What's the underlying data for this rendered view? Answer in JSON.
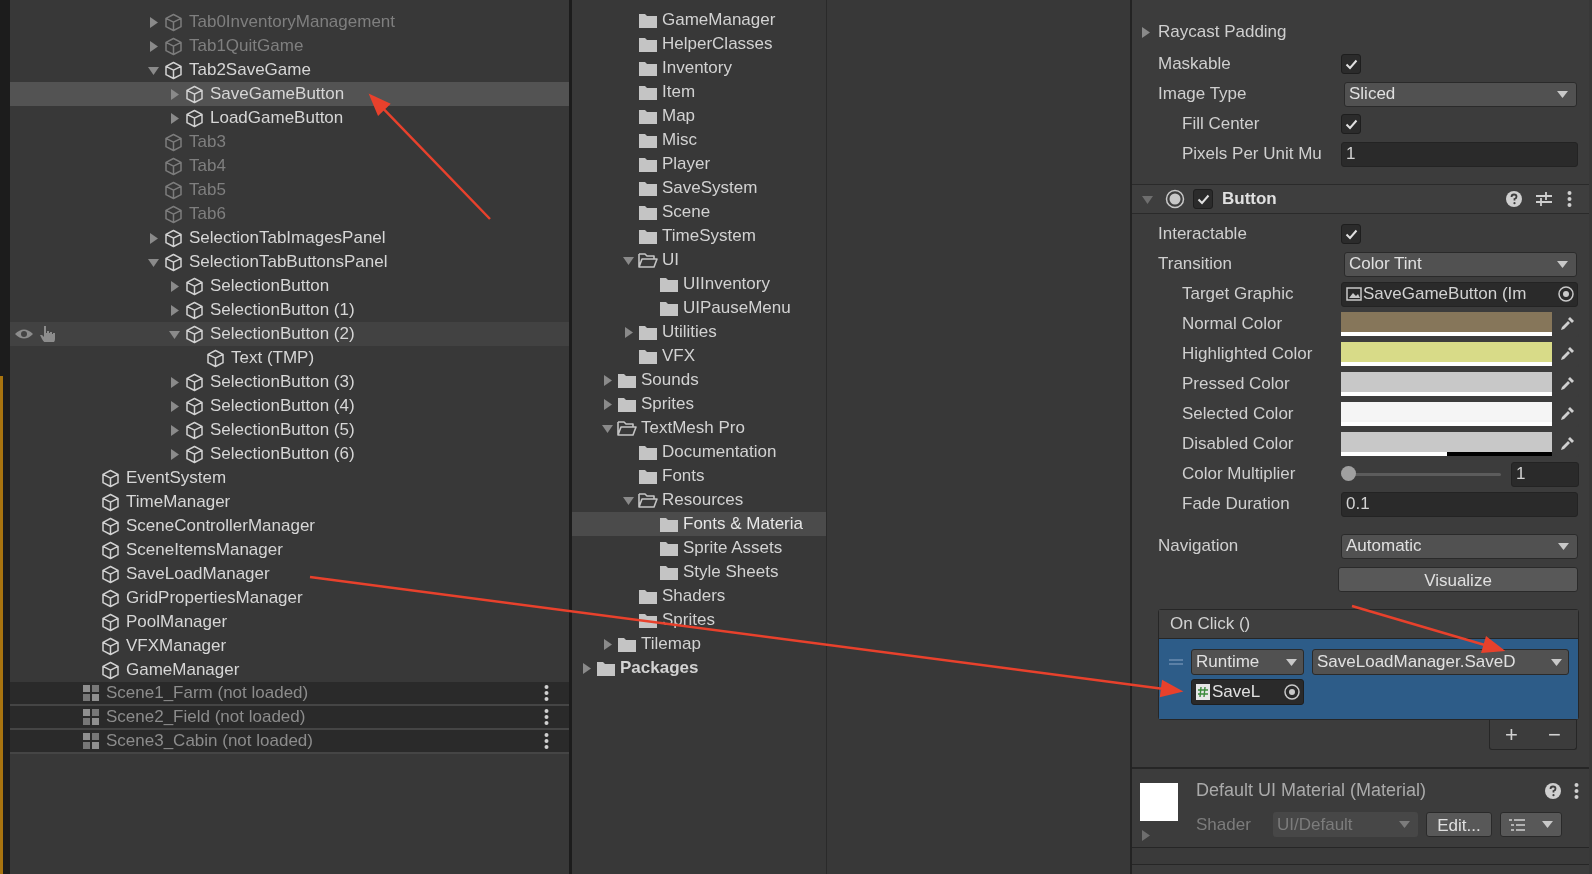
{
  "hierarchy": {
    "partial_branch": [
      {
        "name": "Tab0InventoryManagement",
        "active": false,
        "expanded": false,
        "selected": false,
        "hovered": false
      },
      {
        "name": "Tab1QuitGame",
        "active": false,
        "expanded": false,
        "selected": false,
        "hovered": false
      },
      {
        "name": "Tab2SaveGame",
        "active": true,
        "expanded": true,
        "selected": false,
        "hovered": false,
        "children": [
          {
            "name": "SaveGameButton",
            "active": true,
            "expanded": false,
            "selected": true,
            "hovered": false
          },
          {
            "name": "LoadGameButton",
            "active": true,
            "expanded": false,
            "selected": false,
            "hovered": false
          }
        ]
      },
      {
        "name": "Tab3",
        "active": false,
        "selected": false,
        "hovered": false
      },
      {
        "name": "Tab4",
        "active": false,
        "selected": false,
        "hovered": false
      },
      {
        "name": "Tab5",
        "active": false,
        "selected": false,
        "hovered": false
      },
      {
        "name": "Tab6",
        "active": false,
        "selected": false,
        "hovered": false
      },
      {
        "name": "SelectionTabImagesPanel",
        "active": true,
        "expanded": false,
        "selected": false,
        "hovered": false
      },
      {
        "name": "SelectionTabButtonsPanel",
        "active": true,
        "expanded": true,
        "selected": false,
        "hovered": false,
        "children": [
          {
            "name": "SelectionButton",
            "active": true,
            "expanded": false,
            "selected": false,
            "hovered": false
          },
          {
            "name": "SelectionButton (1)",
            "active": true,
            "expanded": false,
            "selected": false,
            "hovered": false
          },
          {
            "name": "SelectionButton (2)",
            "active": true,
            "expanded": true,
            "selected": false,
            "hovered": true,
            "children": [
              {
                "name": "Text (TMP)",
                "active": true,
                "selected": false,
                "hovered": false
              }
            ]
          },
          {
            "name": "SelectionButton (3)",
            "active": true,
            "expanded": false,
            "selected": false,
            "hovered": false
          },
          {
            "name": "SelectionButton (4)",
            "active": true,
            "expanded": false,
            "selected": false,
            "hovered": false
          },
          {
            "name": "SelectionButton (5)",
            "active": true,
            "expanded": false,
            "selected": false,
            "hovered": false
          },
          {
            "name": "SelectionButton (6)",
            "active": true,
            "expanded": false,
            "selected": false,
            "hovered": false
          }
        ]
      }
    ],
    "root_objects": [
      {
        "name": "EventSystem",
        "active": true,
        "selected": false,
        "hovered": false
      },
      {
        "name": "TimeManager",
        "active": true,
        "selected": false,
        "hovered": false
      },
      {
        "name": "SceneControllerManager",
        "active": true,
        "selected": false,
        "hovered": false
      },
      {
        "name": "SceneItemsManager",
        "active": true,
        "selected": false,
        "hovered": false
      },
      {
        "name": "SaveLoadManager",
        "active": true,
        "selected": false,
        "hovered": false
      },
      {
        "name": "GridPropertiesManager",
        "active": true,
        "selected": false,
        "hovered": false
      },
      {
        "name": "PoolManager",
        "active": true,
        "selected": false,
        "hovered": false
      },
      {
        "name": "VFXManager",
        "active": true,
        "selected": false,
        "hovered": false
      },
      {
        "name": "GameManager",
        "active": true,
        "selected": false,
        "hovered": false
      }
    ],
    "scenes": [
      {
        "name": "Scene1_Farm (not loaded)"
      },
      {
        "name": "Scene2_Field (not loaded)"
      },
      {
        "name": "Scene3_Cabin (not loaded)"
      }
    ]
  },
  "project": {
    "partial_branch": [
      {
        "name": "GameManager",
        "selected": false
      },
      {
        "name": "HelperClasses",
        "selected": false
      },
      {
        "name": "Inventory",
        "selected": false
      },
      {
        "name": "Item",
        "selected": false
      },
      {
        "name": "Map",
        "selected": false
      },
      {
        "name": "Misc",
        "selected": false
      },
      {
        "name": "Player",
        "selected": false
      },
      {
        "name": "SaveSystem",
        "selected": false
      },
      {
        "name": "Scene",
        "selected": false
      },
      {
        "name": "TimeSystem",
        "selected": false
      },
      {
        "name": "UI",
        "expanded": true,
        "selected": false,
        "children": [
          {
            "name": "UIInventory",
            "selected": false
          },
          {
            "name": "UIPauseMenu",
            "selected": false
          }
        ]
      },
      {
        "name": "Utilities",
        "expanded": false,
        "selected": false
      },
      {
        "name": "VFX",
        "selected": false
      }
    ],
    "assets_children": [
      {
        "name": "Sounds",
        "expanded": false,
        "selected": false
      },
      {
        "name": "Sprites",
        "expanded": false,
        "selected": false
      },
      {
        "name": "TextMesh Pro",
        "expanded": true,
        "selected": false,
        "children": [
          {
            "name": "Documentation",
            "selected": false
          },
          {
            "name": "Fonts",
            "selected": false
          },
          {
            "name": "Resources",
            "expanded": true,
            "selected": false,
            "children": [
              {
                "name": "Fonts & Materia",
                "selected": true
              },
              {
                "name": "Sprite Assets",
                "selected": false
              },
              {
                "name": "Style Sheets",
                "selected": false
              }
            ]
          },
          {
            "name": "Shaders",
            "selected": false
          },
          {
            "name": "Sprites",
            "selected": false
          }
        ]
      },
      {
        "name": "Tilemap",
        "expanded": false,
        "selected": false
      }
    ],
    "roots": [
      {
        "name": "Packages",
        "expanded": false,
        "selected": false
      }
    ]
  },
  "inspector": {
    "image_rows": [
      {
        "kind": "foldout",
        "label": "Raycast Padding",
        "expanded": false
      },
      {
        "kind": "checkbox",
        "label": "Maskable",
        "checked": true
      },
      {
        "kind": "dropdown",
        "label": "Image Type",
        "value": "Sliced",
        "children": [
          {
            "kind": "checkbox",
            "label": "Fill Center",
            "checked": true
          },
          {
            "kind": "number",
            "label": "Pixels Per Unit Mu",
            "value": "1"
          }
        ]
      }
    ],
    "component": {
      "title": "Button",
      "enabled": true,
      "expanded": true,
      "rows": [
        {
          "kind": "checkbox",
          "label": "Interactable",
          "checked": true
        },
        {
          "kind": "dropdown",
          "label": "Transition",
          "value": "Color Tint",
          "children": [
            {
              "kind": "object",
              "label": "Target Graphic",
              "value": "SaveGameButton (Im"
            },
            {
              "kind": "color",
              "label": "Normal Color",
              "color": "#86765a",
              "level": 1
            },
            {
              "kind": "color",
              "label": "Highlighted Color",
              "color": "#d8db88",
              "level": 1
            },
            {
              "kind": "color",
              "label": "Pressed Color",
              "color": "#c8c8c8",
              "level": 1
            },
            {
              "kind": "color",
              "label": "Selected Color",
              "color": "#f5f5f5",
              "level": 1
            },
            {
              "kind": "color",
              "label": "Disabled Color",
              "color": "#c8c8c8",
              "level": 0.5
            },
            {
              "kind": "slider",
              "label": "Color Multiplier",
              "level": 0,
              "value": "1"
            },
            {
              "kind": "number",
              "label": "Fade Duration",
              "value": "0.1"
            }
          ]
        }
      ],
      "navigation": {
        "label": "Navigation",
        "value": "Automatic"
      },
      "visualize_button": "Visualize",
      "on_click": {
        "title": "On Click ()",
        "entries": [
          {
            "runtime": "Runtime",
            "function": "SaveLoadManager.SaveD",
            "target": "SaveL",
            "selected": true
          }
        ],
        "add": "+",
        "remove": "−"
      }
    },
    "material": {
      "title": "Default UI Material (Material)",
      "shader_label": "Shader",
      "shader": "UI/Default",
      "edit_button": "Edit..."
    }
  }
}
